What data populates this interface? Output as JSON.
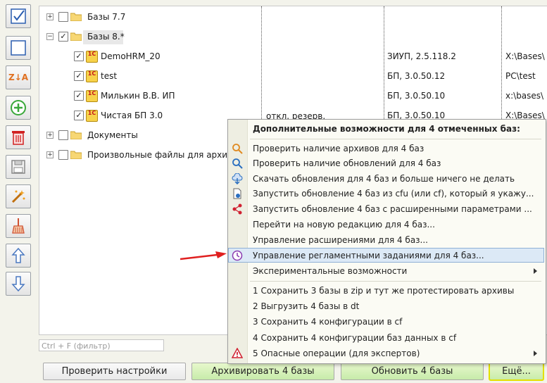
{
  "toolbar": {
    "buttons": [
      "check-all-icon",
      "uncheck-all-icon",
      "sort-icon",
      "add-icon",
      "delete-icon",
      "save-icon",
      "wand-icon",
      "broom-icon",
      "arrow-up-icon",
      "arrow-down-icon"
    ],
    "sort_glyph": "Z↓A"
  },
  "tree": {
    "rows": [
      {
        "label": "Базы 7.7",
        "col2": "",
        "col3": ""
      },
      {
        "label": "Базы 8.*",
        "col2": "",
        "col3": ""
      },
      {
        "label": "DemoHRM_20",
        "col2": "ЗИУП, 2.5.118.2",
        "col3": "X:\\Bases\\"
      },
      {
        "label": "test",
        "col2": "БП, 3.0.50.12",
        "col3": "PC\\test"
      },
      {
        "label": "Милькин В.В. ИП",
        "col2": "БП, 3.0.50.10",
        "col3": "x:\\bases\\"
      },
      {
        "label": "Чистая БП 3.0",
        "col2": "БП, 3.0.50.10",
        "col3": "X:\\Bases\\",
        "col1": "откл. резерв."
      },
      {
        "label": "Документы",
        "col2": "",
        "col3": ""
      },
      {
        "label": "Произвольные файлы для архива",
        "col2": "",
        "col3": ""
      }
    ],
    "check_glyph": "✓",
    "db_icon_text": "1C"
  },
  "filter": {
    "placeholder": "Ctrl + F (фильтр)"
  },
  "buttons": {
    "check_settings": "Проверить настройки",
    "archive": "Архивировать 4 базы",
    "update": "Обновить 4 базы",
    "more": "Ещё..."
  },
  "menu": {
    "title": "Дополнительные возможности для 4 отмеченных баз:",
    "group1": [
      "Проверить наличие архивов для 4 баз",
      "Проверить наличие обновлений для 4 баз",
      "Скачать обновления для 4 баз и больше ничего не делать",
      "Запустить обновление 4 баз из cfu (или cf), который я укажу...",
      "Запустить обновление 4 баз с расширенными параметрами ...",
      "Перейти на новую редакцию для 4 баз...",
      "Управление расширениями для 4 баз...",
      "Управление регламентными заданиями для 4 баз..."
    ],
    "experimental": "Экспериментальные возможности",
    "group2": [
      "1 Сохранить 3 базы в zip и тут же протестировать архивы",
      "2 Выгрузить 4 базы в dt",
      "3 Сохранить 4 конфигурации в cf",
      "4 Сохранить 4 конфигурации баз данных в cf",
      "5 Опасные операции (для экспертов)"
    ],
    "highlight_color": "#dce9f6"
  },
  "annotation": {
    "arrow_color": "#e02020"
  }
}
